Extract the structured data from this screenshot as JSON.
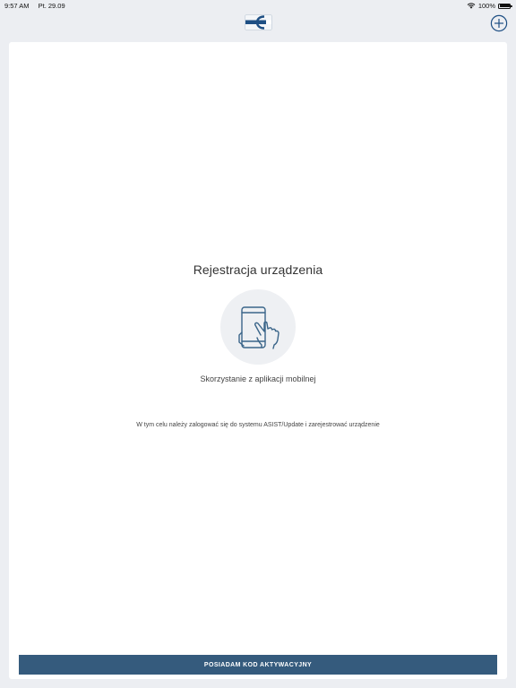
{
  "status_bar": {
    "time": "9:57 AM",
    "date": "Pt. 29.09",
    "battery": "100%",
    "icons": [
      "wifi-icon",
      "battery-icon"
    ]
  },
  "nav": {
    "logo": "app-logo",
    "add_icon": "plus-circle-icon",
    "accent_color": "#1e4f84"
  },
  "content": {
    "title": "Rejestracja urządzenia",
    "illustration": "phone-tap-icon",
    "subtitle": "Skorzystanie z aplikacji mobilnej",
    "description": "W tym celu należy zalogować się do systemu ASIST/Update i zarejestrować urządzenie"
  },
  "footer": {
    "button_label": "POSIADAM KOD AKTYWACYJNY",
    "button_color": "#355b7d"
  }
}
